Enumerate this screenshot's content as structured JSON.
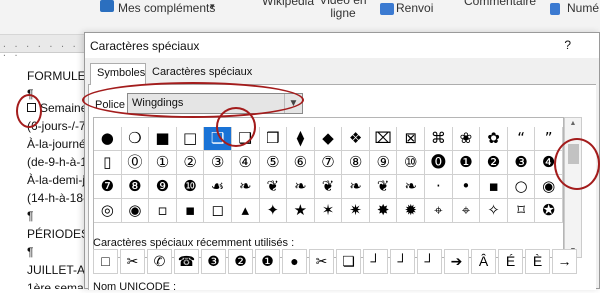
{
  "ribbon": {
    "mes_complements": "Mes compléments",
    "wikipedia": "Wikipédia",
    "video_en_ligne": "Vidéo en ligne",
    "renvoi": "Renvoi",
    "commentaire": "Commentaire",
    "numero": "Numé"
  },
  "document": {
    "lines": [
      "FORMULE-",
      "¶",
      "Semaine",
      "(6-jours-/-7",
      "À-la-journé",
      "(de-9-h-à-1",
      "À-la-demi-j",
      "(14-h-à-18-",
      "¶",
      "PÉRIODES-",
      "¶",
      "JUILLET-AO",
      "1ère semai"
    ]
  },
  "dialog": {
    "title": "Caractères spéciaux",
    "help": "?",
    "tabs": [
      "Symboles",
      "Caractères spéciaux"
    ],
    "font_label": "Police :",
    "font_value": "Wingdings",
    "recent_label": "Caractères spéciaux récemment utilisés :",
    "unicode_label": "Nom UNICODE :"
  },
  "symbols": [
    [
      "●",
      "❍",
      "■",
      "□",
      "❏",
      "❑",
      "❒",
      "⧫",
      "◆",
      "❖",
      "⌧",
      "⊠",
      "⌘",
      "❀",
      "✿",
      "“",
      "”"
    ],
    [
      "▯",
      "⓪",
      "①",
      "②",
      "③",
      "④",
      "⑤",
      "⑥",
      "⑦",
      "⑧",
      "⑨",
      "⑩",
      "⓿",
      "❶",
      "❷",
      "❸",
      "❹"
    ],
    [
      "❼",
      "❽",
      "❾",
      "❿",
      "☙",
      "❧",
      "❦",
      "❧",
      "❦",
      "❧",
      "❦",
      "❧",
      "·",
      "•",
      "▪",
      "○",
      "◉"
    ],
    [
      "◎",
      "◉",
      "▫",
      "▪",
      "◻",
      "▴",
      "✦",
      "★",
      "✶",
      "✷",
      "✸",
      "✹",
      "⌖",
      "⌖",
      "✧",
      "⌑",
      "✪"
    ]
  ],
  "selected_symbol": {
    "row": 0,
    "col": 4
  },
  "recent_symbols": [
    "□",
    "✂",
    "✆",
    "☎",
    "❸",
    "❷",
    "❶",
    "●",
    "✂",
    "❏",
    "┘",
    "┘",
    "┘",
    "➔",
    "Â",
    "É",
    "È",
    "→"
  ]
}
